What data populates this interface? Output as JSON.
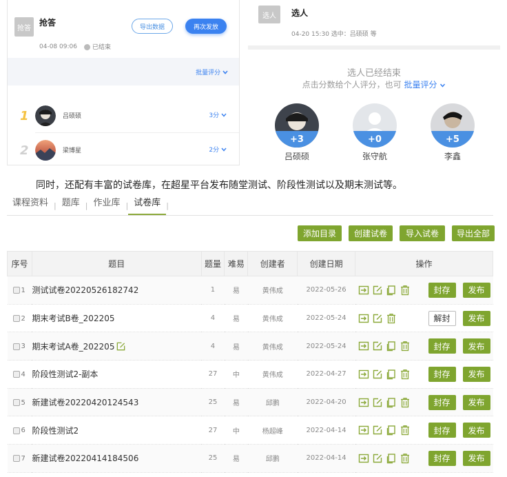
{
  "left_panel": {
    "avatar_text": "抢答",
    "title": "抢答",
    "datetime": "04-08 09:06",
    "status": "已结束",
    "export_button": "导出数据",
    "resend_button": "再次发放",
    "batch_score": "批量评分",
    "entries": [
      {
        "rank": "1",
        "name": "吕硕硕",
        "score": "3分",
        "rank_color": "#f5c242"
      },
      {
        "rank": "2",
        "name": "梁博星",
        "score": "2分",
        "rank_color": "#cfcfcf"
      }
    ]
  },
  "right_panel": {
    "avatar_text": "选人",
    "title": "选人",
    "meta": "04-20 15:30   选中：吕硕硕 等",
    "ended_text": "选人已经结束",
    "hint_text": "点击分数给个人评分，也可",
    "hint_link": "批量评分",
    "people": [
      {
        "name": "吕硕硕",
        "score": "+3"
      },
      {
        "name": "张守航",
        "score": "+0"
      },
      {
        "name": "李鑫",
        "score": "+5"
      }
    ]
  },
  "caption": "同时，还配有丰富的试卷库，在超星平台发布随堂测试、阶段性测试以及期末测试等。",
  "tabs": [
    "课程资料",
    "题库",
    "作业库",
    "试卷库"
  ],
  "active_tab": "试卷库",
  "actions": {
    "add_dir": "添加目录",
    "create": "创建试卷",
    "import": "导入试卷",
    "export_all": "导出全部"
  },
  "table": {
    "headers": {
      "index": "序号",
      "title": "题目",
      "count": "题量",
      "difficulty": "难易",
      "creator": "创建者",
      "date": "创建日期",
      "ops": "操作"
    },
    "rows": [
      {
        "index": "1",
        "title": "测试试卷20220526182742",
        "count": "1",
        "difficulty": "易",
        "creator": "黄伟成",
        "date": "2022-05-26",
        "lock_label": "封存",
        "publish_label": "发布"
      },
      {
        "index": "2",
        "title": "期末考试B卷_202205",
        "count": "4",
        "difficulty": "易",
        "creator": "黄伟成",
        "date": "2022-05-24",
        "lock_label": "解封",
        "publish_label": "发布"
      },
      {
        "index": "3",
        "title": "期末考试A卷_202205",
        "count": "4",
        "difficulty": "易",
        "creator": "黄伟成",
        "date": "2022-05-24",
        "lock_label": "封存",
        "publish_label": "发布"
      },
      {
        "index": "4",
        "title": "阶段性测试2-副本",
        "count": "27",
        "difficulty": "中",
        "creator": "黄伟成",
        "date": "2022-04-27",
        "lock_label": "封存",
        "publish_label": "发布"
      },
      {
        "index": "5",
        "title": "新建试卷20220420124543",
        "count": "25",
        "difficulty": "易",
        "creator": "邱鹏",
        "date": "2022-04-20",
        "lock_label": "封存",
        "publish_label": "发布"
      },
      {
        "index": "6",
        "title": "阶段性测试2",
        "count": "27",
        "difficulty": "中",
        "creator": "杨超峰",
        "date": "2022-04-14",
        "lock_label": "封存",
        "publish_label": "发布"
      },
      {
        "index": "7",
        "title": "新建试卷20220414184506",
        "count": "25",
        "difficulty": "易",
        "creator": "邱鹏",
        "date": "2022-04-14",
        "lock_label": "封存",
        "publish_label": "发布"
      }
    ]
  },
  "colors": {
    "accent_green": "#7fa52f",
    "accent_blue": "#3b82f0"
  }
}
